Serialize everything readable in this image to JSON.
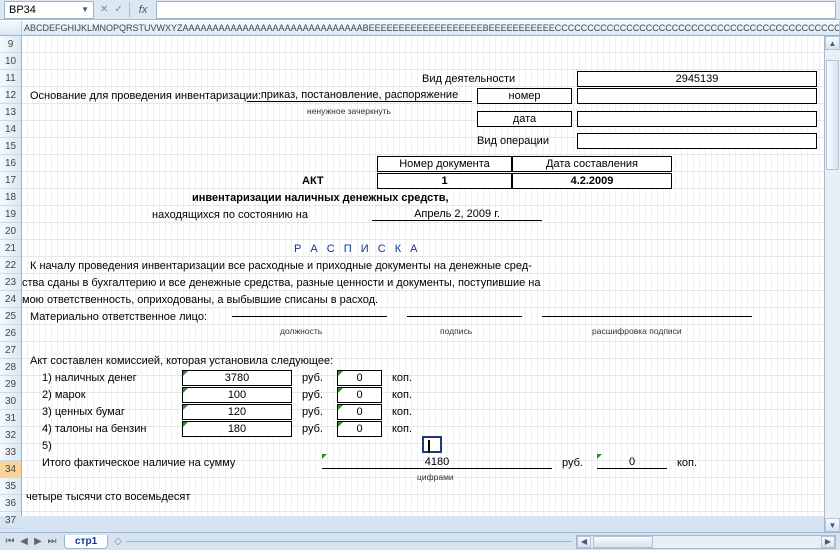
{
  "nameBox": "BP34",
  "colHeaderLetters": "ABCDEFGHIJKLMNOPQRSTUVWXYZAAAAAAAAAAAAAAAAAAAAAAAAAAAAAABEEEEEEEEEEEEEEEEEEEBEEEEEEEEEEECCCCCCCCCCCCCCCCCCCCCCCCCCCCCCCCCCCCCCCCCCCCCCCCCCCCCCCC",
  "highlightCol": "E",
  "rows": [
    "9",
    "10",
    "11",
    "12",
    "13",
    "14",
    "15",
    "16",
    "17",
    "18",
    "19",
    "20",
    "21",
    "22",
    "23",
    "24",
    "25",
    "26",
    "27",
    "28",
    "29",
    "30",
    "31",
    "32",
    "33",
    "34",
    "35",
    "36",
    "37"
  ],
  "selectedRow": "34",
  "sheetTab": "стр1",
  "labels": {
    "activityType": "Вид деятельности",
    "activityValue": "2945139",
    "basis": "Основание для проведения инвентаризации:",
    "orderUnderline": "приказ,   постановление,  распоряжение",
    "orderNote": "ненужное зачеркнуть",
    "number": "номер",
    "date": "дата",
    "operationType": "Вид операции",
    "docNumber": "Номер документа",
    "docDate": "Дата составления",
    "akt": "АКТ",
    "docNumVal": "1",
    "docDateVal": "4.2.2009",
    "aktTitle": "инвентаризации наличных денежных средств,",
    "asOf": "находящихся по состоянию на",
    "asOfDate": "Апрель 2, 2009 г.",
    "raspiska": "Р А С П И С К А",
    "para1": "К  началу  проведения  инвентаризации  все  расходные  и  приходные  документы  на  денежные  сред-",
    "para2": "ства сданы  в бухгалтерию  и все  денежные  средства,  разные  ценности  и документы, поступившие на",
    "para3": "мою ответственность, оприходованы, а выбывшие списаны в расход.",
    "respPerson": "Материально ответственное лицо:",
    "post": "должность",
    "sign": "подпись",
    "signDecode": "расшифровка подписи",
    "commission": "Акт составлен комиссией, которая установила следующее:",
    "item1": "1) наличных денег",
    "item2": "2) марок",
    "item3": "3) ценных бумаг",
    "item4": "4) талоны на бензин",
    "item5": "5)",
    "rub": "руб.",
    "kop": "коп.",
    "v1": "3780",
    "k1": "0",
    "v2": "100",
    "k2": "0",
    "v3": "120",
    "k3": "0",
    "v4": "180",
    "k4": "0",
    "totalLabel": "Итого фактическое наличие на сумму",
    "totalVal": "4180",
    "totalKop": "0",
    "digits": "цифрами",
    "words": "четыре тысячи сто восемьдесят"
  },
  "chart_data": {
    "type": "table",
    "title": "АКТ инвентаризации наличных денежных средств",
    "document_number": 1,
    "document_date": "4.2.2009",
    "as_of_date": "Апрель 2, 2009 г.",
    "activity_code": 2945139,
    "items": [
      {
        "n": 1,
        "label": "наличных денег",
        "rub": 3780,
        "kop": 0
      },
      {
        "n": 2,
        "label": "марок",
        "rub": 100,
        "kop": 0
      },
      {
        "n": 3,
        "label": "ценных бумаг",
        "rub": 120,
        "kop": 0
      },
      {
        "n": 4,
        "label": "талоны на бензин",
        "rub": 180,
        "kop": 0
      }
    ],
    "total_rub": 4180,
    "total_kop": 0,
    "total_in_words": "четыре тысячи сто восемьдесят"
  }
}
